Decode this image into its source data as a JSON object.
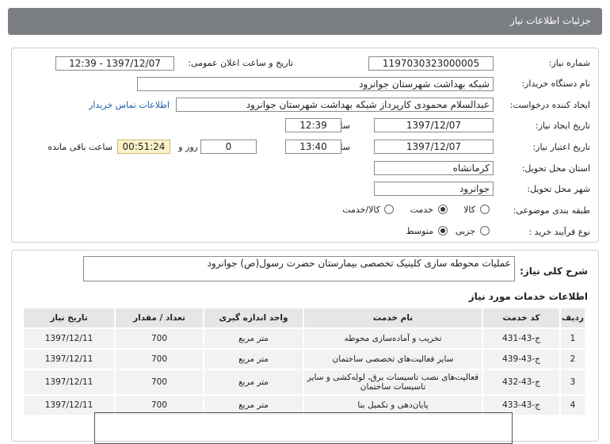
{
  "header": {
    "title": "جزئیات اطلاعات نیاز"
  },
  "form": {
    "need_number": {
      "label": "شماره نیاز:",
      "value": "1197030323000005"
    },
    "announce": {
      "label": "تاریخ و ساعت اعلان عمومی:",
      "value": "1397/12/07 - 12:39"
    },
    "buyer": {
      "label": "نام دستگاه خریدار:",
      "value": "شبکه بهداشت شهرستان جوانرود"
    },
    "requester": {
      "label": "ایجاد کننده درخواست:",
      "value": "عبدالسلام محمودی کارپرداز شبکه بهداشت شهرستان جوانرود",
      "contact_link": "اطلاعات تماس خریدار"
    },
    "created": {
      "label": "تاریخ ایجاد نیاز:",
      "date": "1397/12/07",
      "time_label": "ساعت",
      "time": "12:39"
    },
    "validity": {
      "label": "تاریخ اعتبار نیاز:",
      "date": "1397/12/07",
      "time_label": "ساعت",
      "time": "13:40",
      "days": "0",
      "days_label": "روز و",
      "remaining": "00:51:24",
      "remaining_label": "ساعت باقی مانده"
    },
    "province": {
      "label": "استان محل تحویل:",
      "value": "کرمانشاه"
    },
    "city": {
      "label": "شهر محل تحویل:",
      "value": "جوانرود"
    },
    "category": {
      "label": "طبقه بندی موضوعی:",
      "options": [
        "کالا",
        "خدمت",
        "کالا/خدمت"
      ],
      "selected": "خدمت"
    },
    "process": {
      "label": "نوع فرآیند خرید :",
      "options": [
        "جزیی",
        "متوسط"
      ],
      "selected": "متوسط"
    }
  },
  "summary": {
    "label": "شرح کلی نیاز:",
    "value": "عملیات محوطه سازی کلینیک تخصصی بیمارستان حضرت رسول(ص) جوانرود"
  },
  "services": {
    "title": "اطلاعات خدمات مورد نیاز",
    "columns": [
      "ردیف",
      "کد خدمت",
      "نام خدمت",
      "واحد اندازه گیری",
      "تعداد / مقدار",
      "تاریخ نیاز"
    ],
    "rows": [
      [
        "1",
        "ج-43-431",
        "تخریب و آماده‌سازی محوطه",
        "متر مربع",
        "700",
        "1397/12/11"
      ],
      [
        "2",
        "ج-43-439",
        "سایر فعالیت‌های تخصصی ساختمان",
        "متر مربع",
        "700",
        "1397/12/11"
      ],
      [
        "3",
        "ج-43-432",
        "فعالیت‌های نصب تاسیسات برق، لوله‌کشی و سایر تاسیسات ساختمان",
        "متر مربع",
        "700",
        "1397/12/11"
      ],
      [
        "4",
        "ج-43-433",
        "پایان‌دهی و تکمیل بنا",
        "متر مربع",
        "700",
        "1397/12/11"
      ]
    ]
  }
}
